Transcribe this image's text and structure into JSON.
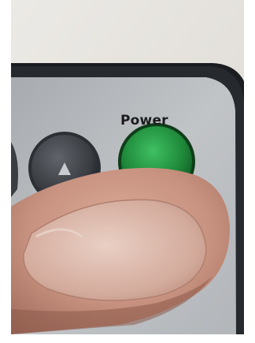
{
  "remote": {
    "power_label": "Power",
    "power_button_color": "#1f8a3a",
    "arrow_button_color": "#3a3d42",
    "panel_color": "#b9bcbf",
    "bezel_color": "#1a1c1f"
  },
  "icons": {
    "arrow_button_icon": "arrow-up-icon"
  }
}
